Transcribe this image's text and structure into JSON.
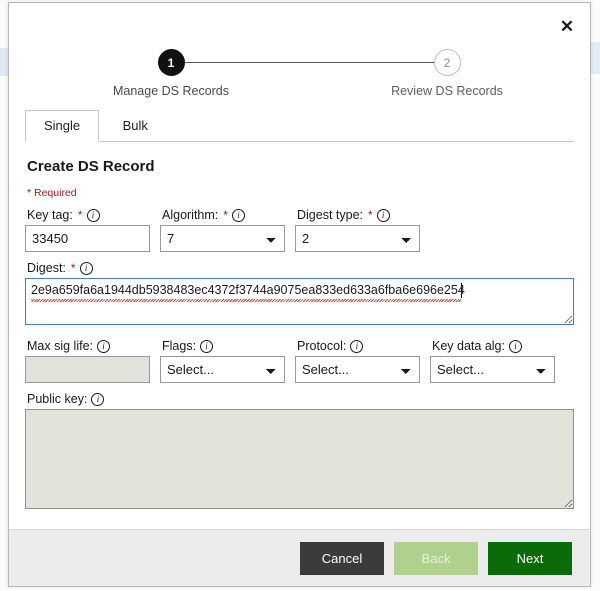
{
  "modal": {
    "close_label": "✕",
    "stepper": {
      "steps": [
        {
          "number": "1",
          "label": "Manage DS Records",
          "state": "active"
        },
        {
          "number": "2",
          "label": "Review DS Records",
          "state": "inactive"
        }
      ]
    },
    "tabs": [
      {
        "label": "Single",
        "state": "active"
      },
      {
        "label": "Bulk",
        "state": "inactive"
      }
    ],
    "title": "Create DS Record",
    "required_note": "* Required",
    "info_glyph": "i",
    "required_star": "*",
    "fields": {
      "key_tag": {
        "label": "Key tag:",
        "value": "33450",
        "placeholder": ""
      },
      "algorithm": {
        "label": "Algorithm:",
        "value": "7"
      },
      "digest_type": {
        "label": "Digest type:",
        "value": "2"
      },
      "digest": {
        "label": "Digest:",
        "value": "2e9a659fa6a1944db5938483ec4372f3744a9075ea833ed633a6fba6e696e254"
      },
      "max_sig_life": {
        "label": "Max sig life:",
        "value": "",
        "placeholder": ""
      },
      "flags": {
        "label": "Flags:",
        "value": "Select..."
      },
      "protocol": {
        "label": "Protocol:",
        "value": "Select..."
      },
      "key_data_alg": {
        "label": "Key data alg:",
        "value": "Select..."
      },
      "public_key": {
        "label": "Public key:",
        "value": "",
        "placeholder": ""
      }
    },
    "footer": {
      "cancel_label": "Cancel",
      "back_label": "Back",
      "next_label": "Next"
    },
    "colors": {
      "accent_next": "#0a6b09",
      "cancel": "#3b3b3b",
      "back_disabled": "#b0d08d",
      "required": "#a01b1b",
      "focus_border": "#4a7ebb",
      "step_active": "#111111"
    }
  }
}
